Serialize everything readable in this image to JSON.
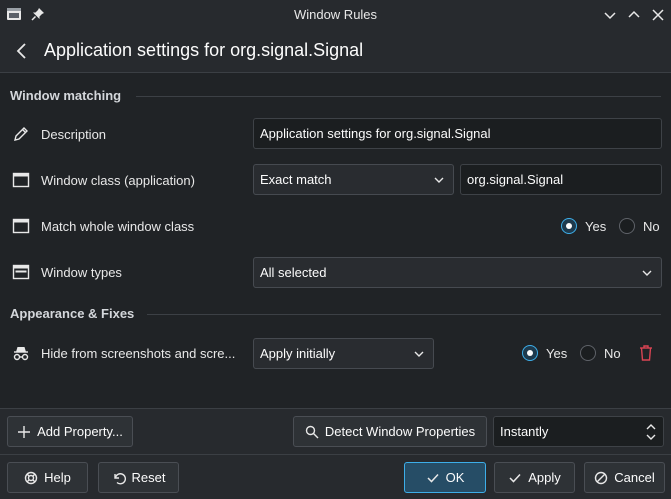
{
  "window": {
    "title": "Window Rules"
  },
  "header": {
    "title": "Application settings for org.signal.Signal"
  },
  "sections": {
    "window_matching": "Window matching",
    "appearance": "Appearance & Fixes"
  },
  "rows": {
    "description": {
      "label": "Description",
      "value": "Application settings for org.signal.Signal"
    },
    "window_class": {
      "label": "Window class (application)",
      "match": "Exact match",
      "value": "org.signal.Signal"
    },
    "whole_class": {
      "label": "Match whole window class",
      "yes": "Yes",
      "no": "No",
      "selected": "Yes"
    },
    "window_types": {
      "label": "Window types",
      "value": "All selected"
    },
    "hide_screens": {
      "label": "Hide from screenshots and scre...",
      "policy": "Apply initially",
      "yes": "Yes",
      "no": "No",
      "selected": "Yes"
    }
  },
  "toolbar": {
    "add_property": "Add Property...",
    "detect": "Detect Window Properties",
    "delay": "Instantly"
  },
  "footer": {
    "help": "Help",
    "reset": "Reset",
    "ok": "OK",
    "apply": "Apply",
    "cancel": "Cancel"
  },
  "colors": {
    "accent": "#3daee9",
    "delete": "#da4453",
    "background": "#202326"
  }
}
